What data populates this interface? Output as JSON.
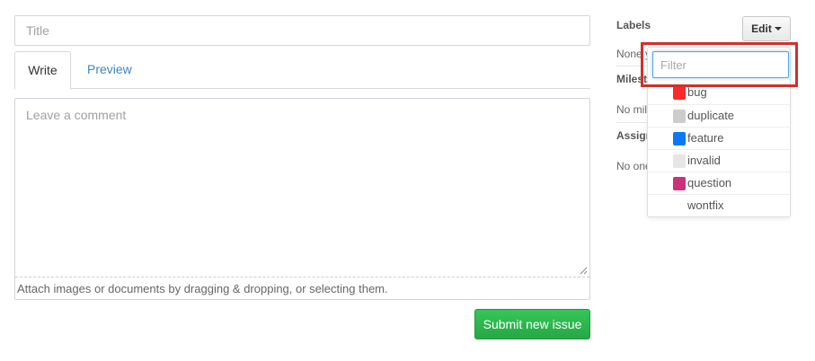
{
  "form": {
    "title_placeholder": "Title",
    "tabs": [
      {
        "label": "Write"
      },
      {
        "label": "Preview"
      }
    ],
    "comment_placeholder": "Leave a comment",
    "attach_hint": "Attach images or documents by dragging & dropping, or selecting them.",
    "submit_label": "Submit new issue"
  },
  "sidebar": {
    "labels_heading": "Labels",
    "labels_value": "None yet",
    "edit_label": "Edit",
    "milestone_heading": "Milestone",
    "milestone_value": "No milestone",
    "assignee_heading": "Assignee",
    "assignee_value": "No one"
  },
  "labels_dropdown": {
    "filter_placeholder": "Filter",
    "items": [
      {
        "name": "bug",
        "color": "#fc2929"
      },
      {
        "name": "duplicate",
        "color": "#cccccc"
      },
      {
        "name": "feature",
        "color": "#0b79f4"
      },
      {
        "name": "invalid",
        "color": "#e6e6e6"
      },
      {
        "name": "question",
        "color": "#cc317c"
      },
      {
        "name": "wontfix",
        "color": "#ffffff"
      }
    ]
  },
  "colors": {
    "accent_link": "#4183c4",
    "submit_green": "#2cbe4e",
    "highlight_red": "#d0302a"
  }
}
